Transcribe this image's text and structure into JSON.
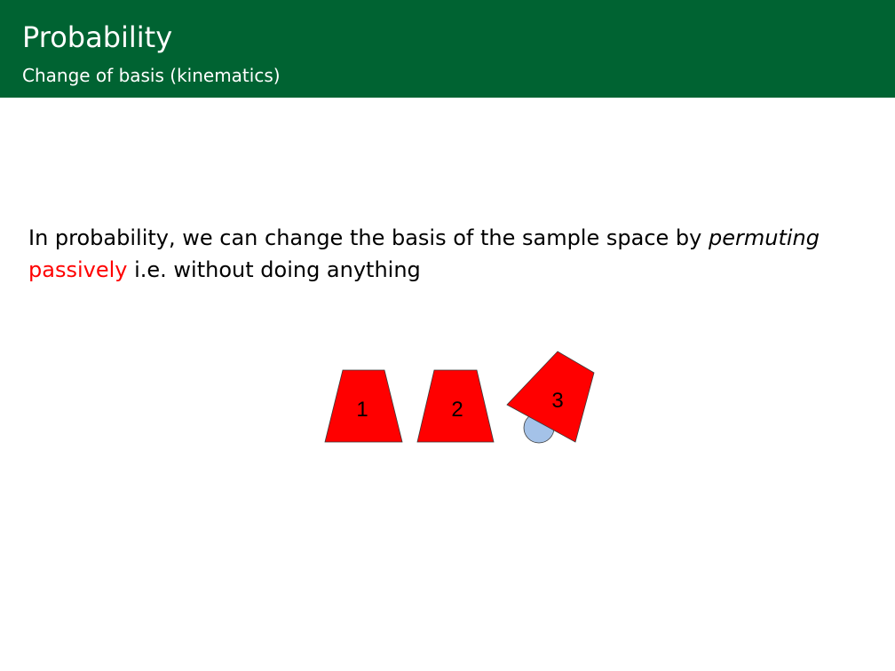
{
  "header": {
    "title": "Probability",
    "subtitle": "Change of basis (kinematics)"
  },
  "body": {
    "line1_text": "In probability, we can change the basis of the sample space by ",
    "line1_emph": "permuting",
    "line2_red": "passively",
    "line2_text": " i.e.  without doing anything"
  },
  "figure": {
    "cups": [
      {
        "label": "1"
      },
      {
        "label": "2"
      },
      {
        "label": "3"
      }
    ],
    "colors": {
      "cup": "#ff0000",
      "cup_outline": "#3a3a3a",
      "ball": "#a4c2e8",
      "header": "#006332"
    }
  }
}
